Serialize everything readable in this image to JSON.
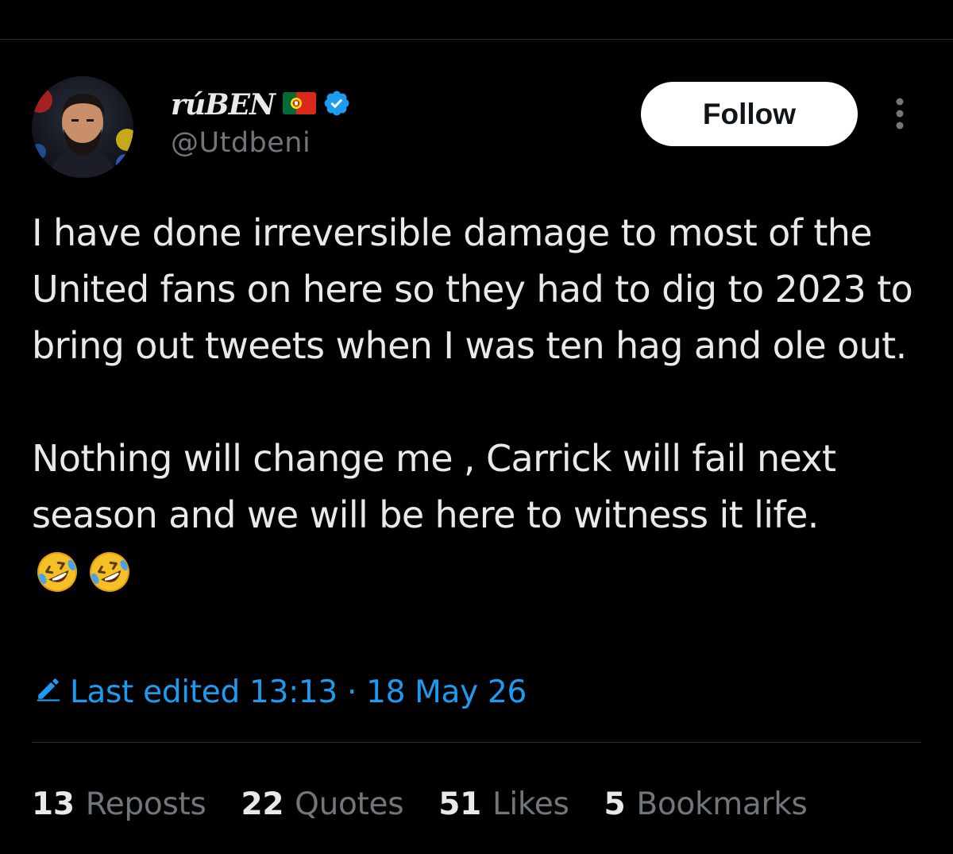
{
  "author": {
    "display_name": "rúBEN",
    "handle": "@Utdbeni",
    "flag_icon": "portugal-flag-icon",
    "verified_icon": "verified-badge-icon",
    "verified_color": "#1d9bf0"
  },
  "actions": {
    "follow_label": "Follow",
    "more_icon": "more-vertical-icon"
  },
  "tweet": {
    "paragraph_1": "I have done irreversible damage to most of the United fans on here so they had to dig to 2023 to bring out tweets when I was ten hag and ole out.",
    "paragraph_2": "Nothing will change me , Carrick will fail next season and we will be here to witness it life.",
    "emojis": [
      "🤣",
      "🤣"
    ]
  },
  "edited": {
    "icon": "pencil-icon",
    "label": "Last edited 13:13",
    "separator": "·",
    "date": "18 May 26",
    "color": "#1d9bf0"
  },
  "stats": [
    {
      "count": "13",
      "label": "Reposts"
    },
    {
      "count": "22",
      "label": "Quotes"
    },
    {
      "count": "51",
      "label": "Likes"
    },
    {
      "count": "5",
      "label": "Bookmarks"
    }
  ],
  "theme": {
    "background": "#000000",
    "text_primary": "#e7e9ea",
    "text_secondary": "#71767b",
    "divider": "#2f3336"
  }
}
